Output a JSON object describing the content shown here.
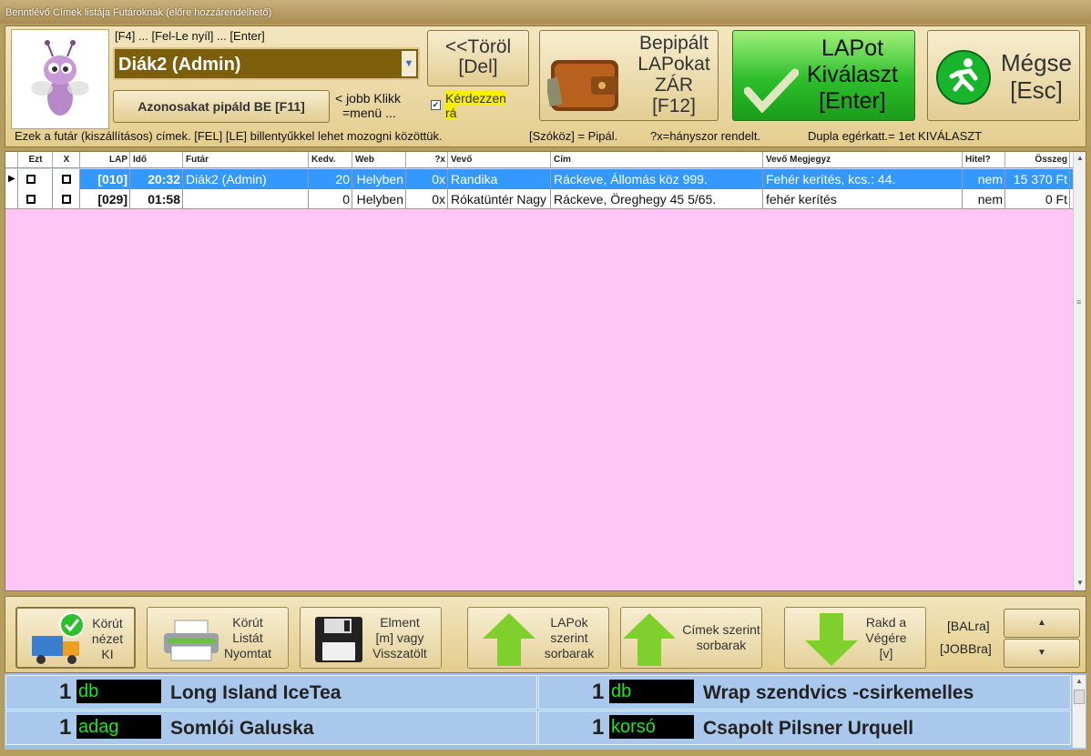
{
  "window": {
    "title": "Benntlévő Címek listája Futároknak (előre hozzárendelhető)"
  },
  "top": {
    "hint": "[F4] ... [Fel-Le nyíl] ... [Enter]",
    "courier_value": "Diák2 (Admin)",
    "select_same_button": "Azonosakat pipáld BE [F11]",
    "right_click_hint_1": "< jobb Klikk",
    "right_click_hint_2": "=menü ...",
    "delete_button_1": "<<Töröl",
    "delete_button_2": "[Del]",
    "ask_checkbox_1": "Kérdezzen",
    "ask_checkbox_2": "rá",
    "ask_checked": true,
    "close_button": [
      "Bepipált",
      "LAPokat",
      "ZÁR",
      "[F12]"
    ],
    "select_button": [
      "LAPot",
      "Kiválaszt",
      "[Enter]"
    ],
    "cancel_button": [
      "Mégse",
      "[Esc]"
    ]
  },
  "info": {
    "text1": "Ezek a futár (kiszállításos) címek. [FEL] [LE] billentyűkkel lehet mozogni közöttük.",
    "text2": "[Szóköz] = Pipál.",
    "text3": "?x=hányszor rendelt.",
    "text4": "Dupla egérkatt.= 1et KIVÁLASZT"
  },
  "grid": {
    "headers": [
      "Ezt",
      "X",
      "LAP",
      "Idő",
      "Futár",
      "Kedv.",
      "Web",
      "?x",
      "Vevő",
      "Cím",
      "Vevő Megjegyz",
      "Hitel?",
      "Összeg"
    ],
    "rows": [
      {
        "lap": "[010]",
        "ido": "20:32",
        "futar": "Diák2 (Admin)",
        "kedv": "20",
        "web": "Helyben",
        "x": "0x",
        "vevo": "Randika",
        "cim": "Ráckeve, Állomás köz 999.",
        "megj": "Fehér kerítés, kcs.: 44.",
        "hitel": "nem",
        "osszeg": "15 370 Ft"
      },
      {
        "lap": "[029]",
        "ido": "01:58",
        "futar": "",
        "kedv": "0",
        "web": "Helyben",
        "x": "0x",
        "vevo": "Rókatüntér Nagy",
        "cim": "Ráckeve, Öreghegy  45 5/65.",
        "megj": "fehér kerítés",
        "hitel": "nem",
        "osszeg": "0 Ft"
      }
    ]
  },
  "bottom": {
    "route_view": [
      "Körút",
      "nézet",
      "KI"
    ],
    "route_print": [
      "Körút",
      "Listát",
      "Nyomtat"
    ],
    "save": [
      "Elment",
      "[m] vagy",
      "Visszatölt"
    ],
    "sort_lap": [
      "LAPok",
      "szerint",
      "sorbarak"
    ],
    "sort_address": [
      "Címek szerint",
      "sorbarak"
    ],
    "move_end": [
      "Rakd a",
      "Végére",
      "[v]"
    ],
    "left_label": "[BALra]",
    "right_label": "[JOBBra]"
  },
  "items": [
    {
      "qty": "1",
      "unit": "db",
      "name": "Long Island IceTea"
    },
    {
      "qty": "1",
      "unit": "db",
      "name": "Wrap szendvics -csirkemelles"
    },
    {
      "qty": "1",
      "unit": "adag",
      "name": "Somlói Galuska"
    },
    {
      "qty": "1",
      "unit": "korsó",
      "name": "Csapolt Pilsner Urquell"
    }
  ],
  "colors": {
    "selected_row": "#3399ff",
    "grid_bg": "#ffc6f5",
    "unit_text": "#1ce61c"
  }
}
